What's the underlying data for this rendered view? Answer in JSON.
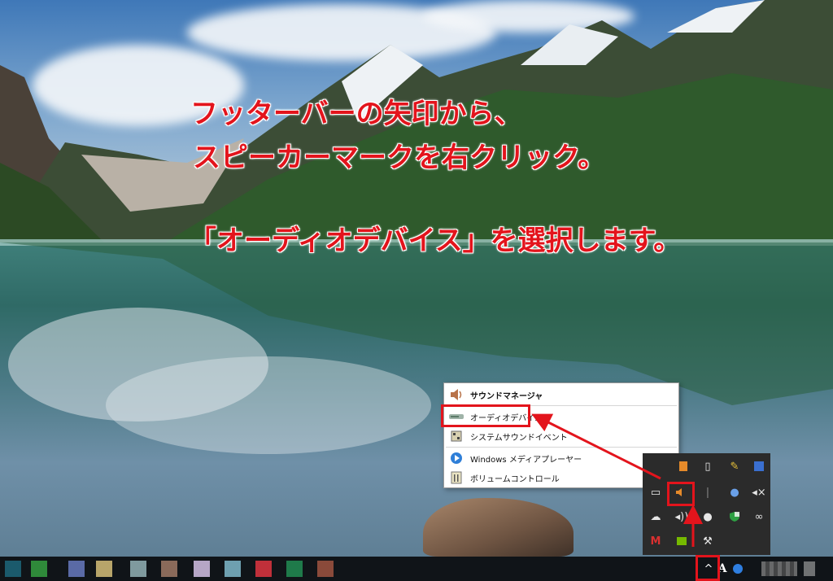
{
  "annotation": {
    "line1": "フッターバーの矢印から、",
    "line2": "スピーカーマークを右クリック。",
    "line3": "「オーディオデバイス」を選択します。"
  },
  "context_menu": {
    "items": [
      {
        "label": "サウンドマネージャ",
        "icon": "speaker-icon"
      },
      {
        "label": "オーディオデバイス",
        "icon": "audio-device-icon"
      },
      {
        "label": "システムサウンドイベント",
        "icon": "system-sound-icon"
      },
      {
        "label": "Windows メディアプレーヤー",
        "icon": "media-player-icon"
      },
      {
        "label": "ボリュームコントロール",
        "icon": "volume-control-icon"
      }
    ]
  },
  "tray": {
    "ime_label": "A",
    "chevron": "^"
  },
  "colors": {
    "accent_red": "#e3141c",
    "tray_bg": "#2b2b2b",
    "taskbar_bg": "#101418"
  }
}
